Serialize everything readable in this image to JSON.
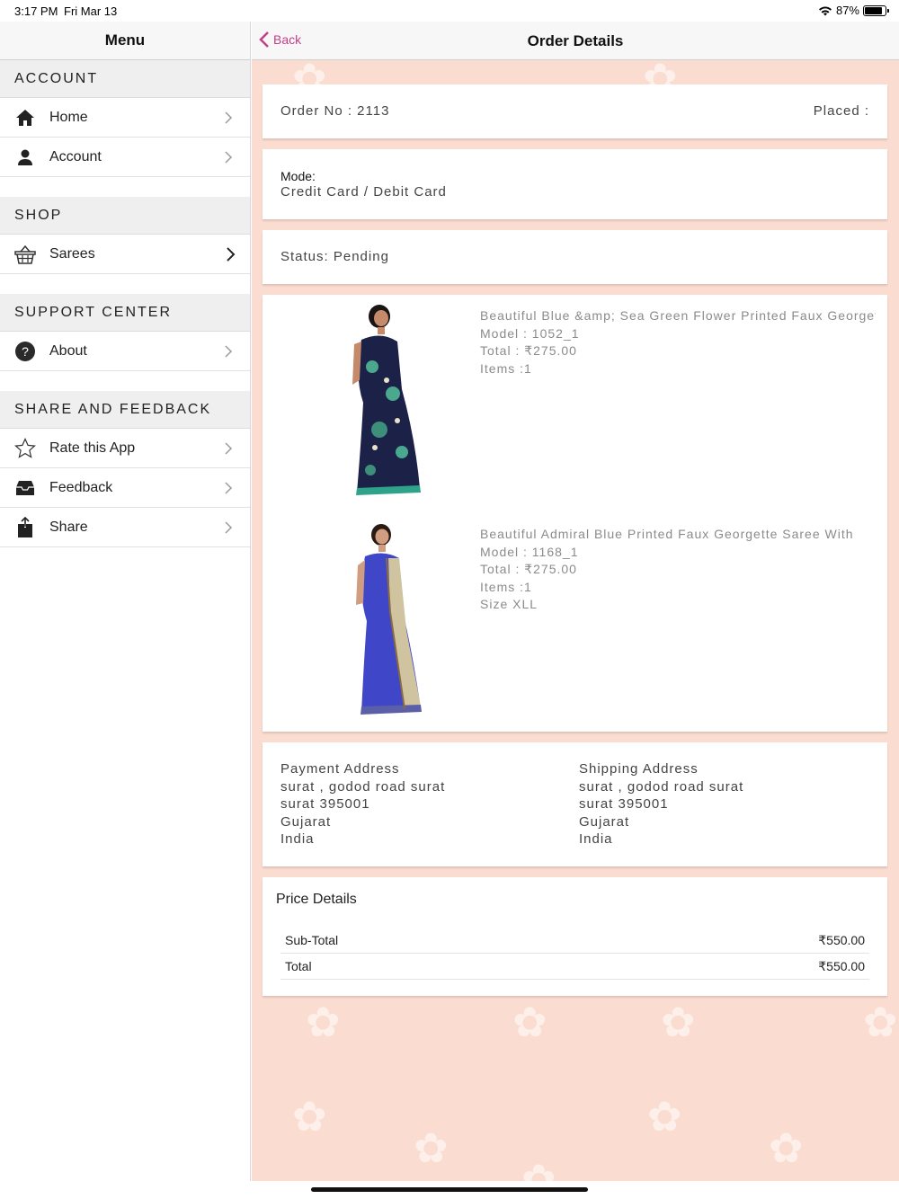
{
  "status_bar": {
    "time": "3:17 PM",
    "date": "Fri Mar 13",
    "battery": "87%",
    "battery_level": 0.87
  },
  "sidebar": {
    "title": "Menu",
    "sections": [
      {
        "heading": "ACCOUNT",
        "items": [
          {
            "label": "Home",
            "icon": "home-icon"
          },
          {
            "label": "Account",
            "icon": "person-icon"
          }
        ]
      },
      {
        "heading": "SHOP",
        "items": [
          {
            "label": "Sarees",
            "icon": "basket-icon"
          }
        ]
      },
      {
        "heading": "SUPPORT CENTER",
        "items": [
          {
            "label": "About",
            "icon": "question-icon"
          }
        ]
      },
      {
        "heading": "SHARE AND FEEDBACK",
        "items": [
          {
            "label": "Rate this App",
            "icon": "star-icon"
          },
          {
            "label": "Feedback",
            "icon": "inbox-icon"
          },
          {
            "label": "Share",
            "icon": "share-icon"
          }
        ]
      }
    ]
  },
  "nav": {
    "back_label": "Back",
    "title": "Order Details"
  },
  "order": {
    "number": "Order No : 2113",
    "placed": "Placed :",
    "mode_label": "Mode:",
    "mode_value": "Credit Card / Debit Card",
    "status": "Status: Pending"
  },
  "products": [
    {
      "name": "Beautiful Blue &amp; Sea Green Flower Printed Faux Georgette Saree",
      "model": "Model : 1052_1",
      "total": "Total : ₹275.00",
      "items": "Items :1",
      "size": ""
    },
    {
      "name": "Beautiful Admiral Blue Printed Faux Georgette Saree With",
      "model": "Model : 1168_1",
      "total": "Total : ₹275.00",
      "items": "Items :1",
      "size": "Size XLL"
    }
  ],
  "payment_address": {
    "heading": "Payment Address",
    "line1": "surat , godod road surat",
    "line2": "surat 395001",
    "line3": "Gujarat",
    "line4": "India"
  },
  "shipping_address": {
    "heading": "Shipping Address",
    "line1": "surat , godod road surat",
    "line2": "surat 395001",
    "line3": "Gujarat",
    "line4": "India"
  },
  "price_details": {
    "title": "Price Details",
    "rows": [
      {
        "label": "Sub-Total",
        "value": "₹550.00"
      },
      {
        "label": "Total",
        "value": "₹550.00"
      }
    ]
  },
  "colors": {
    "accent": "#c0418a",
    "background_pink": "#fbdcd0"
  }
}
